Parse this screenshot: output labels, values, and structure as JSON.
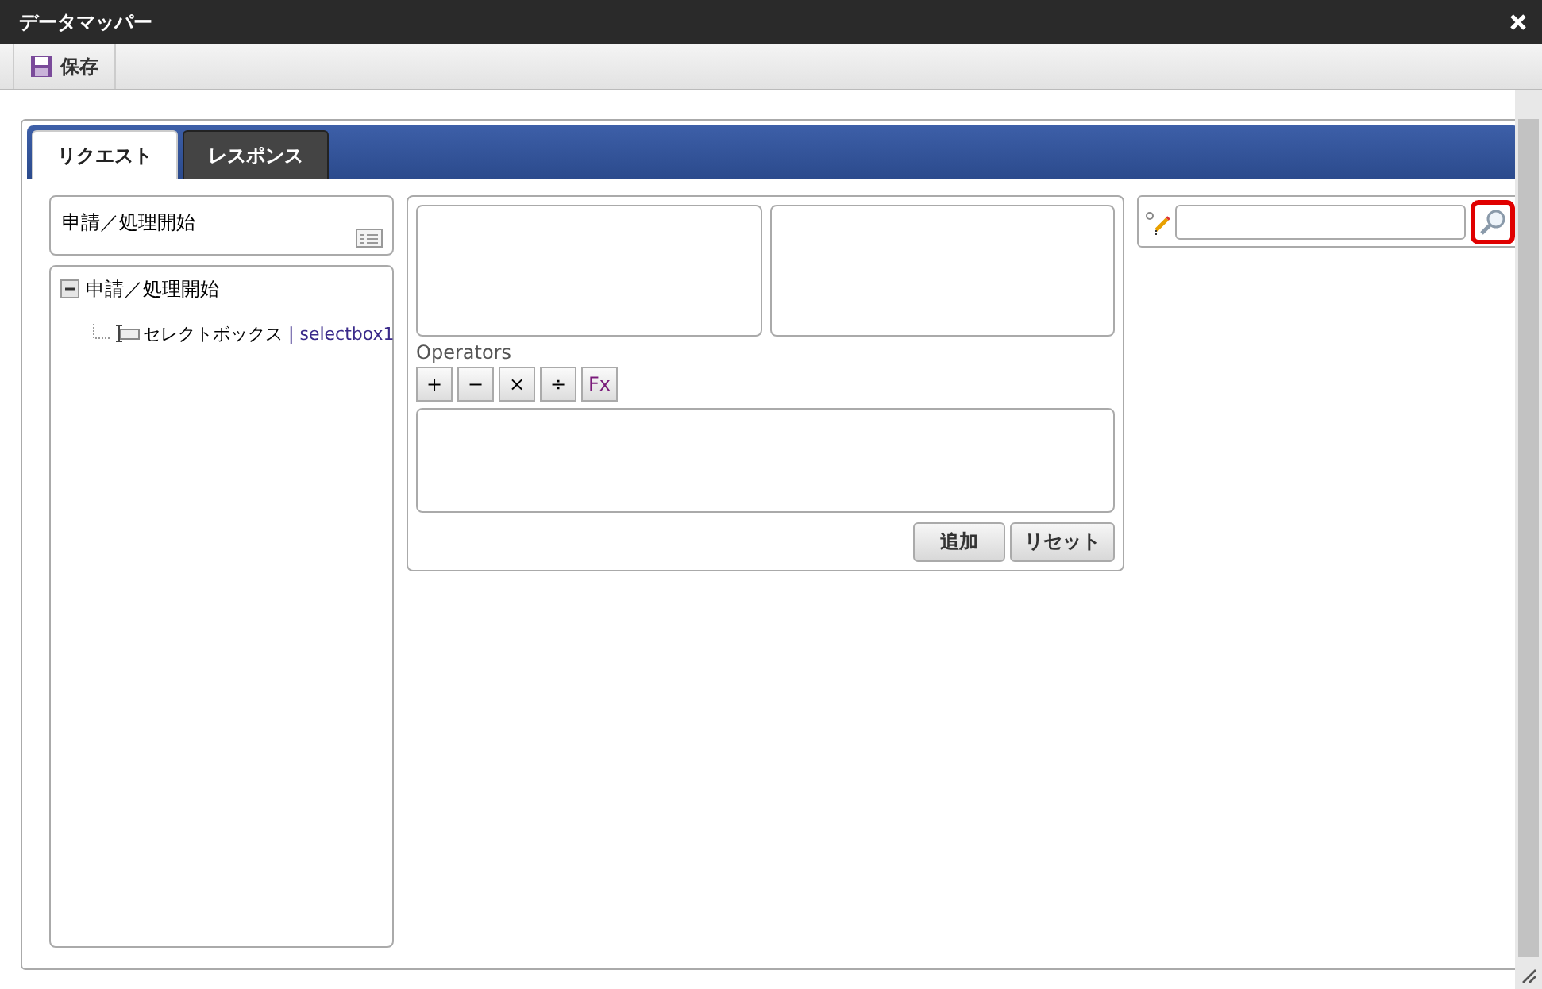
{
  "window": {
    "title": "データマッパー"
  },
  "toolbar": {
    "buttons": [
      {
        "label": "保存"
      }
    ]
  },
  "tabs": [
    {
      "label": "リクエスト",
      "selected": true
    },
    {
      "label": "レスポンス",
      "selected": false
    }
  ],
  "source": {
    "header": "申請／処理開始",
    "tree": [
      {
        "label": "申請／処理開始",
        "expanded": true,
        "children": [
          {
            "label": "セレクトボックス",
            "separator": "|",
            "id_label": "selectbox1"
          }
        ]
      }
    ]
  },
  "editor": {
    "operators_label": "Operators",
    "operators": [
      "+",
      "−",
      "×",
      "÷",
      "Fx"
    ],
    "buttons": [
      "追加",
      "リセット"
    ]
  },
  "search": {
    "highlighted": true
  }
}
